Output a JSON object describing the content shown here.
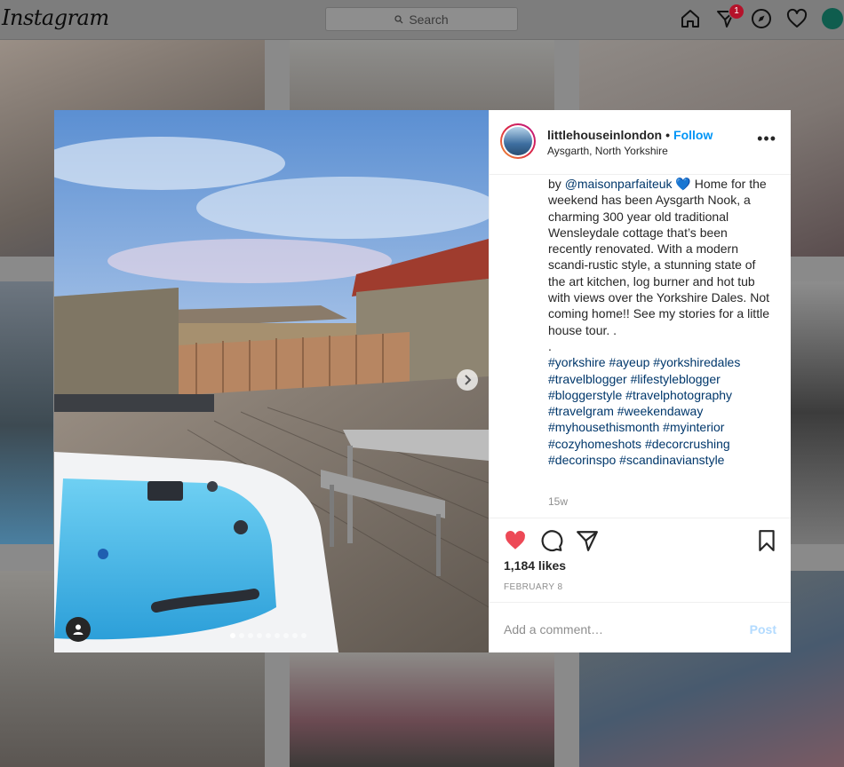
{
  "app": {
    "logo_text": "Instagram",
    "search_placeholder": "Search",
    "notification_count": "1"
  },
  "post": {
    "username": "littlehouseinlondon",
    "separator": "•",
    "follow_label": "Follow",
    "location": "Aysgarth, North Yorkshire",
    "more_label": "•••",
    "caption_prefix": "by ",
    "caption_mention": "@maisonparfaiteuk",
    "caption_body": " 💙 Home for the weekend has been Aysgarth Nook, a charming 300 year old traditional Wensleydale cottage that’s been recently renovated. With a modern scandi-rustic style, a stunning state of the art kitchen, log burner and hot tub with views over the Yorkshire Dales. Not coming home!! See my stories for a little house tour. .\n.",
    "hashtags": [
      "#yorkshire #ayeup #yorkshiredales",
      "#travelblogger #lifestyleblogger",
      "#bloggerstyle #travelphotography",
      "#travelgram #weekendaway",
      "#myhousethismonth #myinterior",
      "#cozyhomeshots #decorcrushing",
      "#decorinspo #scandinavianstyle"
    ],
    "time_ago": "15w",
    "likes": "1,184 likes",
    "date": "FEBRUARY 8",
    "comment_placeholder": "Add a comment…",
    "post_label": "Post",
    "carousel_count": 9,
    "carousel_active": 0
  },
  "colors": {
    "like_red": "#ed4956",
    "link_blue": "#0095f6",
    "hashtag_blue": "#00376b",
    "text": "#262626",
    "muted": "#8e8e8e"
  }
}
